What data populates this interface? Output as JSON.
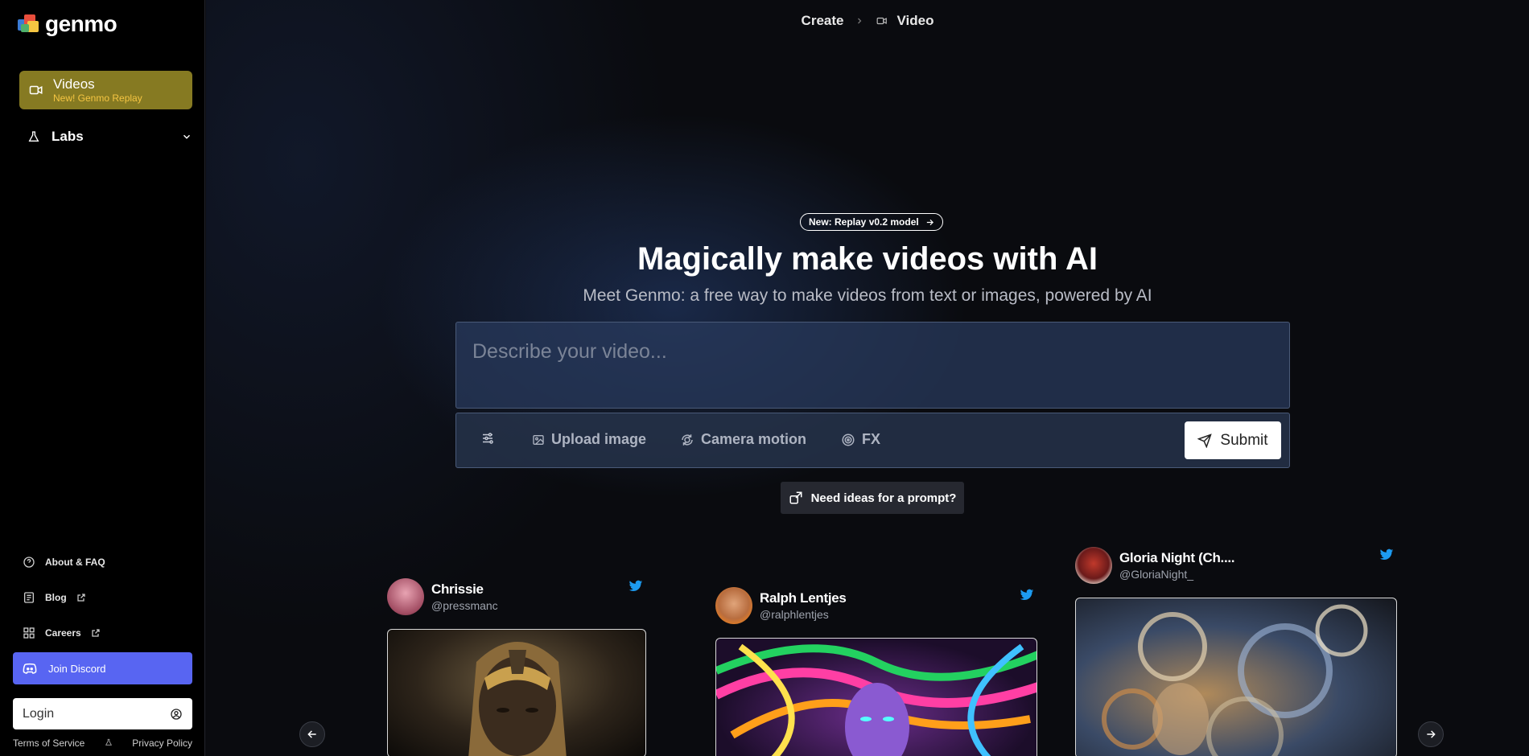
{
  "brand": {
    "name": "genmo"
  },
  "sidebar": {
    "videos": {
      "label": "Videos",
      "sublabel": "New! Genmo Replay"
    },
    "labs": {
      "label": "Labs"
    },
    "links": [
      {
        "label": "About & FAQ",
        "icon": "help-circle-icon"
      },
      {
        "label": "Blog",
        "icon": "document-icon",
        "external": true
      },
      {
        "label": "Careers",
        "icon": "grid-icon",
        "external": true
      }
    ],
    "discord": {
      "label": "Join Discord"
    },
    "login": {
      "label": "Login"
    },
    "footer": {
      "terms": "Terms of Service",
      "privacy": "Privacy Policy"
    }
  },
  "header": {
    "breadcrumb": [
      "Create",
      "Video"
    ]
  },
  "hero": {
    "pill": "New: Replay v0.2 model",
    "title": "Magically make videos with AI",
    "subtitle": "Meet Genmo: a free way to make videos from text or images, powered by AI"
  },
  "prompt": {
    "placeholder": "Describe your video...",
    "toolbar": {
      "upload": "Upload image",
      "camera": "Camera motion",
      "fx": "FX",
      "submit": "Submit"
    },
    "ideas": "Need ideas for a prompt?"
  },
  "cards": [
    {
      "name": "Chrissie",
      "handle": "@pressmanc"
    },
    {
      "name": "Ralph Lentjes",
      "handle": "@ralphlentjes"
    },
    {
      "name": "Gloria Night (Ch....",
      "handle": "@GloriaNight_"
    }
  ],
  "colors": {
    "accent": "#867a22",
    "discord": "#5865f2",
    "twitter": "#1d9bf0"
  }
}
